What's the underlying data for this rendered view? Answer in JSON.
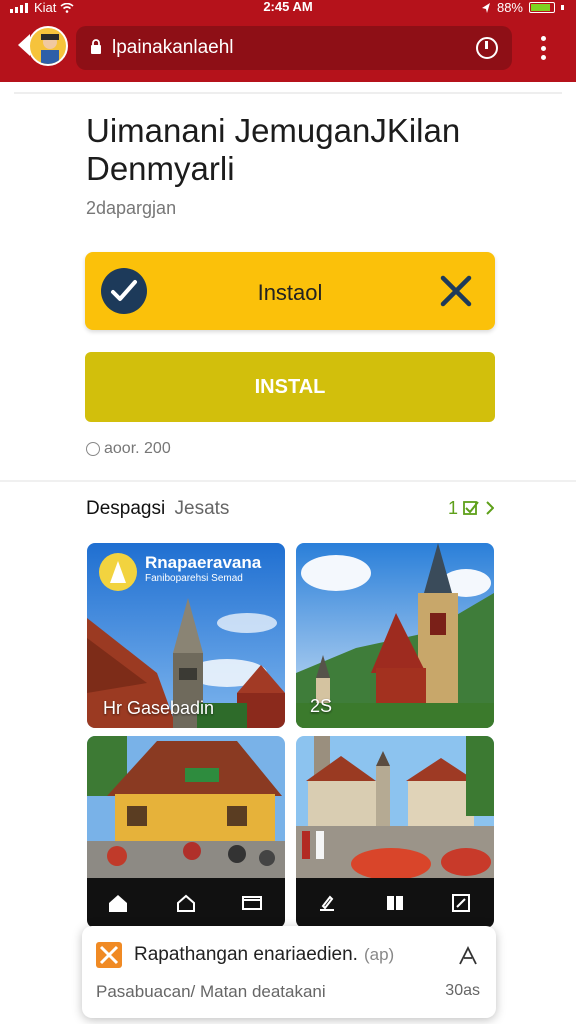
{
  "status_bar": {
    "carrier": "Kiat",
    "time": "2:45 AM",
    "battery": "88%"
  },
  "browser": {
    "url": "lpainakanlaehl"
  },
  "app": {
    "title": "Uimanani JemuganJKilan Denmyarli",
    "subtitle": "2dapargjan",
    "install_primary": "Instaol",
    "install_secondary": "INSTAL",
    "meta": "aoor. 200"
  },
  "section": {
    "heading": "Despagsi",
    "heading_secondary": "Jesats",
    "count": "1"
  },
  "gallery": [
    {
      "title": "Rnapaeravana",
      "subtitle": "Faniboparehsi Semad",
      "caption": "Hr Gasebadin"
    },
    {
      "caption": "2S"
    },
    {
      "caption": ""
    },
    {
      "caption": ""
    }
  ],
  "bottom_sheet": {
    "name": "Rapathangan enariaedien.",
    "tag": "(ap)",
    "subtitle": "Pasabuacan/ Matan deatakani",
    "size": "30as"
  },
  "colors": {
    "browser_bar": "#b5121b",
    "primary_button": "#fbc10a",
    "secondary_button": "#d2bf0c",
    "accent_green": "#5ea01a"
  }
}
